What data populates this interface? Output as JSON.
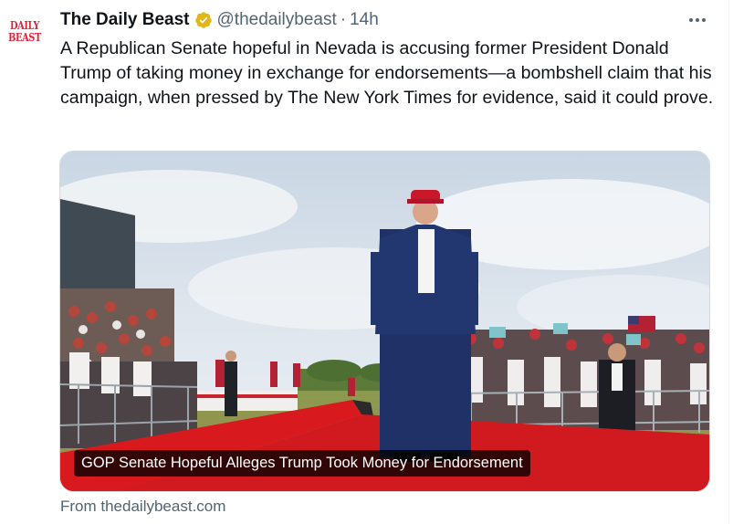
{
  "tweet": {
    "author_name": "The Daily Beast",
    "handle": "@thedailybeast",
    "separator": "·",
    "time": "14h",
    "avatar_logo": "DAILY BEAST",
    "verified_icon": "verified-badge-icon",
    "more_icon": "more-options-icon",
    "text": "A Republican Senate hopeful in Nevada is accusing former President Donald Trump of taking money in exchange for endorsements—a bombshell claim that his campaign, when pressed by The New York Times for evidence, said it could prove."
  },
  "card": {
    "headline": "GOP Senate Hopeful Alleges Trump Took Money for Endorsement",
    "source": "From thedailybeast.com"
  },
  "colors": {
    "text": "#0f1419",
    "muted": "#536471",
    "verified_gold": "#e2b719",
    "logo_red": "#e0243b",
    "carpet_red": "#d8191e"
  }
}
